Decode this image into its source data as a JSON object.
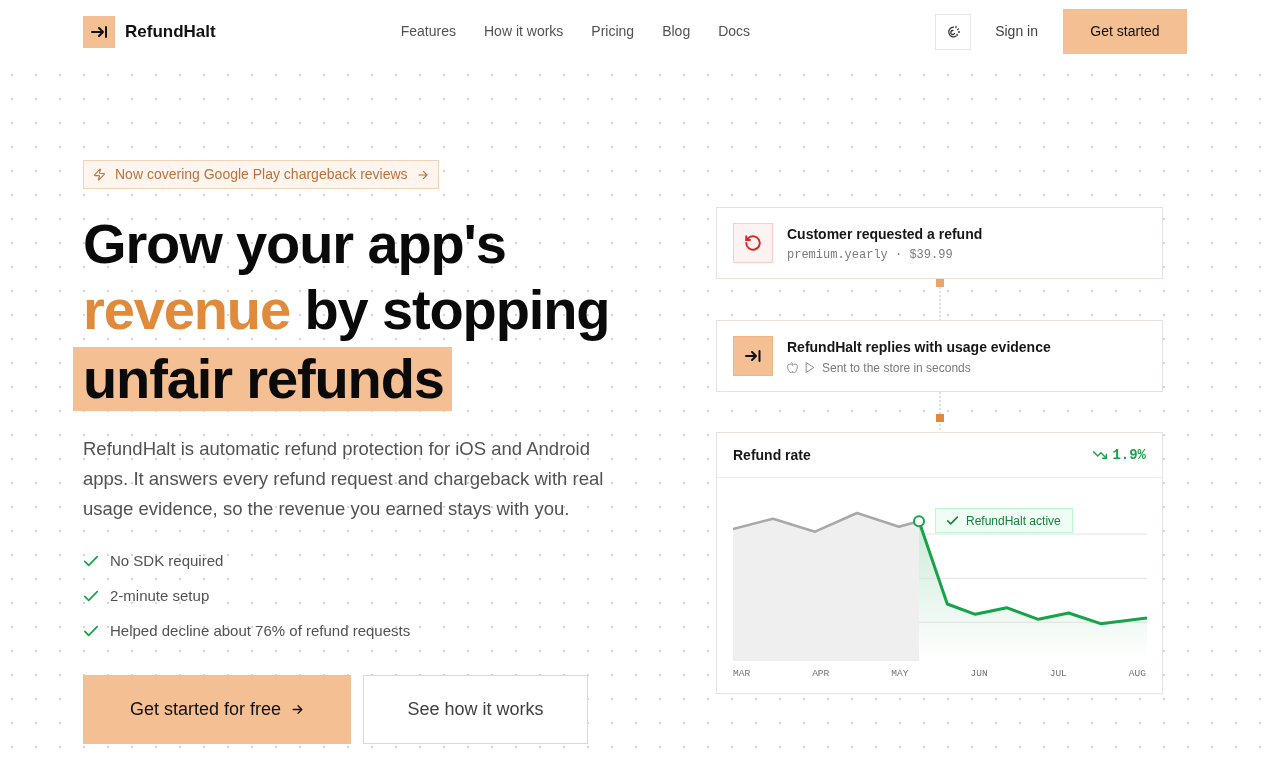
{
  "header": {
    "logo": "RefundHalt",
    "nav": [
      "Features",
      "How it works",
      "Pricing",
      "Blog",
      "Docs"
    ],
    "sign_in": "Sign in",
    "cta": "Get started"
  },
  "hero": {
    "announcement": "Now covering Google Play chargeback reviews",
    "headline": [
      {
        "text": "Grow your app's ",
        "kind": "plain"
      },
      {
        "text": "revenue",
        "kind": "accent"
      },
      {
        "text": " by stopping ",
        "kind": "plain"
      },
      {
        "text": "unfair refunds",
        "kind": "highlight"
      }
    ],
    "description": "RefundHalt is automatic refund protection for iOS and Android apps. It answers every refund request and chargeback with real usage evidence, so the revenue you earned stays with you.",
    "features": [
      "No SDK required",
      "2-minute setup",
      "Helped decline about 76% of refund requests"
    ],
    "buttons": [
      {
        "label": "Get started for free",
        "kind": "primary"
      },
      {
        "label": "See how it works",
        "kind": "secondary"
      }
    ]
  },
  "flow": {
    "steps": [
      {
        "kind": "request",
        "title": "Customer requested a refund",
        "detail": "premium.yearly · $39.99"
      },
      {
        "kind": "reply",
        "title": "RefundHalt replies with usage evidence",
        "detail": "Sent to the store in seconds"
      }
    ]
  },
  "chart_card": {
    "title": "Refund rate",
    "reading": "1.9%",
    "annotation": "RefundHalt active",
    "x_labels": [
      "MAR",
      "APR",
      "MAY",
      "JUN",
      "JUL",
      "AUG"
    ]
  }
}
